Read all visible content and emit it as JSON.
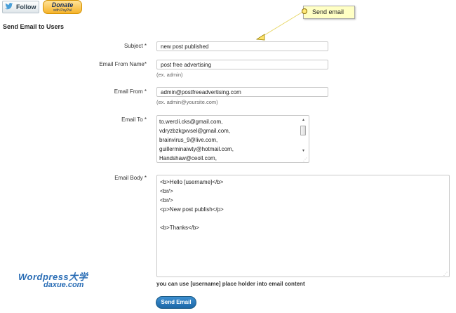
{
  "top_buttons": {
    "follow_label": "Follow",
    "donate_main": "Donate",
    "donate_sub": "with PayPal"
  },
  "tooltip": {
    "text": "Send email"
  },
  "page_title": "Send Email to Users",
  "form": {
    "subject": {
      "label": "Subject *",
      "value": "new post published"
    },
    "from_name": {
      "label": "Email From Name*",
      "value": "post free advertising",
      "hint": "(ex. admin)"
    },
    "from_email": {
      "label": "Email From *",
      "value": "admin@postfreeadvertising.com",
      "hint": "(ex. admin@yoursite.com)"
    },
    "email_to": {
      "label": "Email To *",
      "items": [
        "to.wercli.cks@gmail.com,",
        "vdryzbzkgxvsel@gmail.com,",
        "brainvirus_9@live.com,",
        "guillerminaiwty@hotmail.com,",
        "Handshaw@ceoll.com,"
      ]
    },
    "email_body": {
      "label": "Email Body *",
      "lines": [
        "<b>Hello [username]</b>",
        "<br/>",
        "<br/>",
        "<p>New post publish</p>",
        "",
        "<b>Thanks</b>"
      ]
    },
    "placeholder_note": "you can use [username] place holder into email content",
    "send_button": "Send Email"
  },
  "watermark": {
    "line1": "Wordpress大学",
    "line2": "daxue.com"
  },
  "colors": {
    "accent": "#1c67a7",
    "tooltip_bg": "#ffffc4",
    "donate": "#f6b32a"
  },
  "icons": {
    "follow": "twitter-bird-icon",
    "scroll_up": "arrow-up-icon",
    "scroll_down": "arrow-down-icon"
  }
}
